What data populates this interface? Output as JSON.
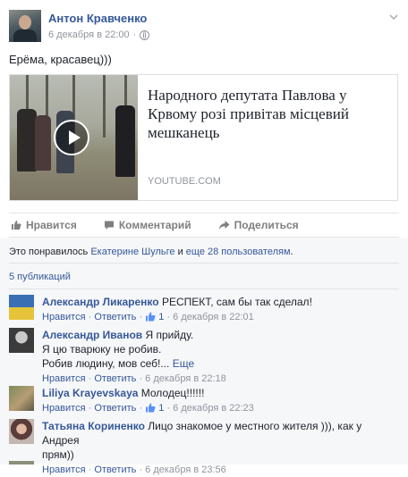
{
  "post": {
    "author": "Антон Кравченко",
    "date": "6 декабря в 22:00",
    "separator": "·",
    "text": "Ерёма, красавец)))",
    "link": {
      "title": "Народного депутата Павлова у Крвому розі привітав місцевий мешканець",
      "domain": "YOUTUBE.COM"
    }
  },
  "actions": {
    "like": "Нравится",
    "comment": "Комментарий",
    "share": "Поделиться"
  },
  "likes": {
    "prefix": "Это понравилось",
    "person": "Екатерине Шульге",
    "middle": "и",
    "others": "еще 28 пользователям",
    "suffix": "."
  },
  "shares": "5 публикаций",
  "comments": [
    {
      "author": "Александр Ликаренко",
      "text": "РЕСПЕКТ, сам бы так сделал!",
      "like": "Нравится",
      "reply": "Ответить",
      "likes_count": "1",
      "date": "6 декабря в 22:01"
    },
    {
      "author": "Александр Иванов",
      "text": "Я прийду.",
      "line2": "Я цю тварюку не робив.",
      "line3": "Робив людину, мов себ!...",
      "more": "Еще",
      "like": "Нравится",
      "reply": "Ответить",
      "date": "6 декабря в 22:18"
    },
    {
      "author": "Liliya Krayevskaya",
      "text": "Молодец!!!!!!",
      "like": "Нравится",
      "reply": "Ответить",
      "likes_count": "1",
      "date": "6 декабря в 22:23"
    },
    {
      "author": "Татьяна Кориненко",
      "text": "Лицо знакомое у местного жителя ))), как у Андрея",
      "line2": "прям))",
      "like": "Нравится",
      "reply": "Ответить",
      "date": "6 декабря в 23:56"
    }
  ],
  "meta_separator": "·"
}
